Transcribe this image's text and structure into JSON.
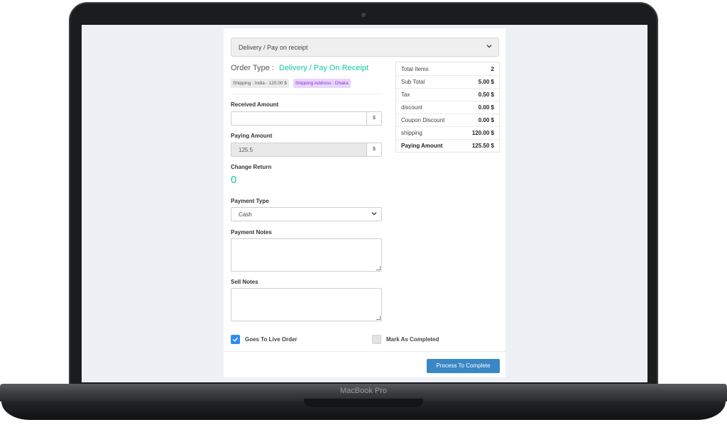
{
  "device": {
    "brand_label": "MacBook Pro"
  },
  "order_select": {
    "value": "Delivery / Pay on receipt"
  },
  "order_type": {
    "label": "Order Type :",
    "value": "Delivery / Pay On Receipt"
  },
  "badges": {
    "shipping": "Shipping : India - 120.00 $",
    "address": "Shipping Address : Dhaka"
  },
  "received_amount": {
    "label": "Received Amount",
    "value": "",
    "addon": "$"
  },
  "paying_amount": {
    "label": "Paying Amount",
    "value": "125.5",
    "addon": "$"
  },
  "change_return": {
    "label": "Change Return",
    "value": "0"
  },
  "payment_type": {
    "label": "Payment Type",
    "value": "Cash"
  },
  "payment_notes": {
    "label": "Payment Notes"
  },
  "sell_notes": {
    "label": "Sell Notes"
  },
  "checkboxes": {
    "live_order": "Goes To Live Order",
    "mark_completed": "Mark As Completed"
  },
  "submit_button": "Process To Complete",
  "summary": [
    {
      "label": "Total Items",
      "value": "2"
    },
    {
      "label": "Sub Total",
      "value": "5.00 $"
    },
    {
      "label": "Tax",
      "value": "0.50 $"
    },
    {
      "label": "discount",
      "value": "0.00 $"
    },
    {
      "label": "Coupon Discount",
      "value": "0.00 $"
    },
    {
      "label": "shipping",
      "value": "120.00 $"
    },
    {
      "label": "Paying Amount",
      "value": "125.50 $"
    }
  ],
  "colors": {
    "accent_green": "#10c9a3",
    "button_blue": "#3a87c6",
    "checkbox_blue": "#2e8cf0",
    "badge_purple": "#8a2be2"
  }
}
